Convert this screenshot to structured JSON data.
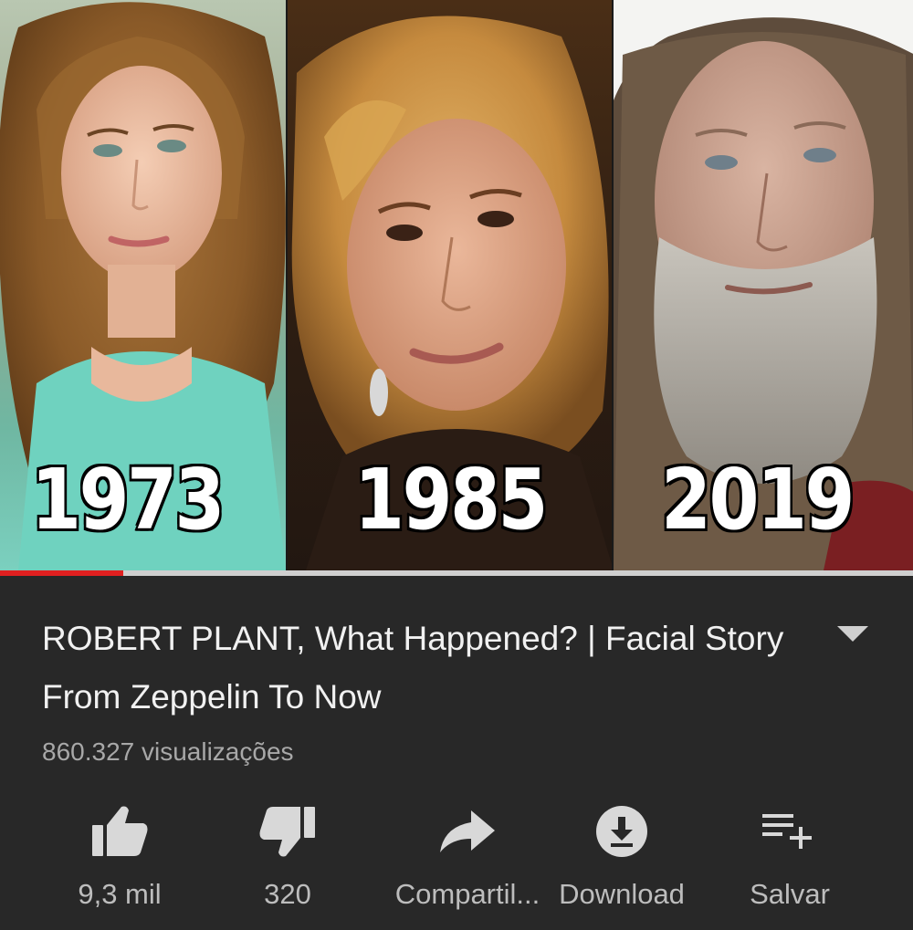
{
  "video": {
    "panels": [
      {
        "year": "1973"
      },
      {
        "year": "1985"
      },
      {
        "year": "2019"
      }
    ],
    "progress_fraction": 0.135,
    "colors": {
      "progress": "#e02020",
      "track": "#cfcfcf"
    }
  },
  "info": {
    "title": "ROBERT PLANT, What Happened? | Facial Story From Zeppelin To Now",
    "views": "860.327 visualizações",
    "expand_icon": "chevron-down-icon"
  },
  "actions": {
    "like": {
      "label": "9,3 mil",
      "icon": "thumbs-up-icon"
    },
    "dislike": {
      "label": "320",
      "icon": "thumbs-down-icon"
    },
    "share": {
      "label": "Compartil...",
      "icon": "share-icon"
    },
    "download": {
      "label": "Download",
      "icon": "download-icon"
    },
    "save": {
      "label": "Salvar",
      "icon": "playlist-add-icon"
    }
  },
  "theme": {
    "background": "#282828",
    "text": "#f1f1f1",
    "muted": "#a8a8a8"
  }
}
